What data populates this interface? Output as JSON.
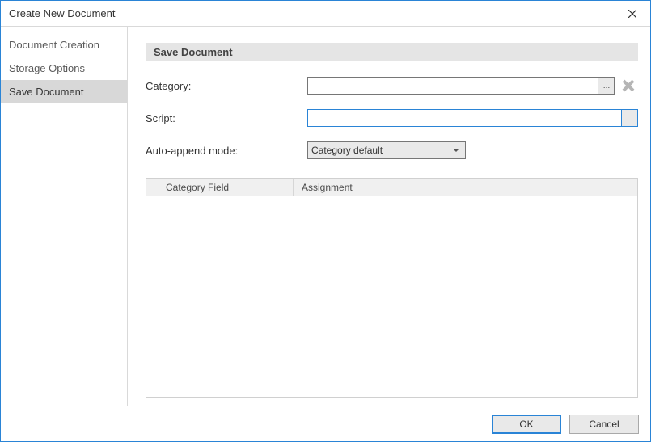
{
  "title": "Create New Document",
  "sidebar": {
    "items": [
      {
        "label": "Document Creation",
        "selected": false
      },
      {
        "label": "Storage Options",
        "selected": false
      },
      {
        "label": "Save Document",
        "selected": true
      }
    ]
  },
  "main": {
    "section_header": "Save Document",
    "category": {
      "label": "Category:",
      "value": ""
    },
    "script": {
      "label": "Script:",
      "value": ""
    },
    "auto_append": {
      "label": "Auto-append mode:",
      "selected": "Category default"
    },
    "table": {
      "columns": [
        "Category Field",
        "Assignment"
      ],
      "rows": []
    }
  },
  "footer": {
    "ok": "OK",
    "cancel": "Cancel"
  }
}
